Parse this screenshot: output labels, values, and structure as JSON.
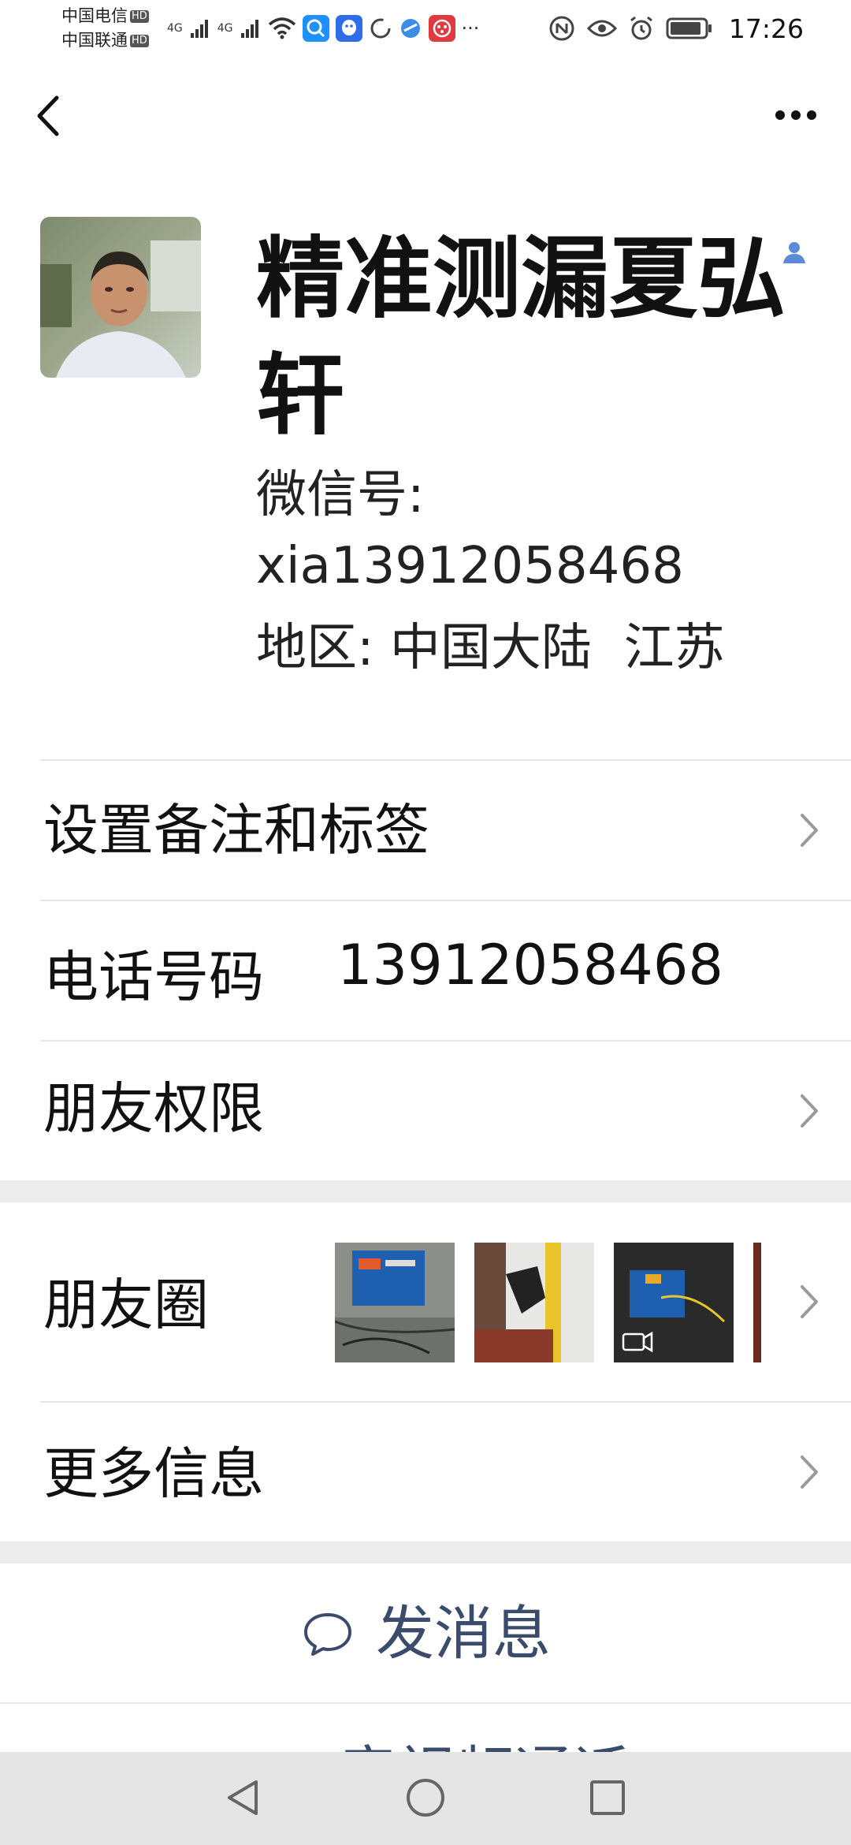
{
  "status_bar": {
    "carrier1": "中国电信",
    "carrier2": "中国联通",
    "hd": "HD",
    "net1": "4G",
    "net2": "4G",
    "more_notifications": "···",
    "time": "17:26"
  },
  "profile": {
    "name": "精准测漏夏弘轩",
    "wechat_id_label": "微信号:",
    "wechat_id": "xia13912058468",
    "region_label": "地区:",
    "region_value": "中国大陆  江苏"
  },
  "rows": {
    "remark": "设置备注和标签",
    "phone_label": "电话号码",
    "phone_value": "13912058468",
    "permissions": "朋友权限",
    "moments": "朋友圈",
    "more_info": "更多信息"
  },
  "actions": {
    "send_message": "发消息",
    "voice_video_call": "音视频通话"
  },
  "colors": {
    "accent": "#3b4b6b",
    "contact_icon": "#5b8bd9",
    "divider": "#e8e8e8",
    "band": "#ededed"
  }
}
